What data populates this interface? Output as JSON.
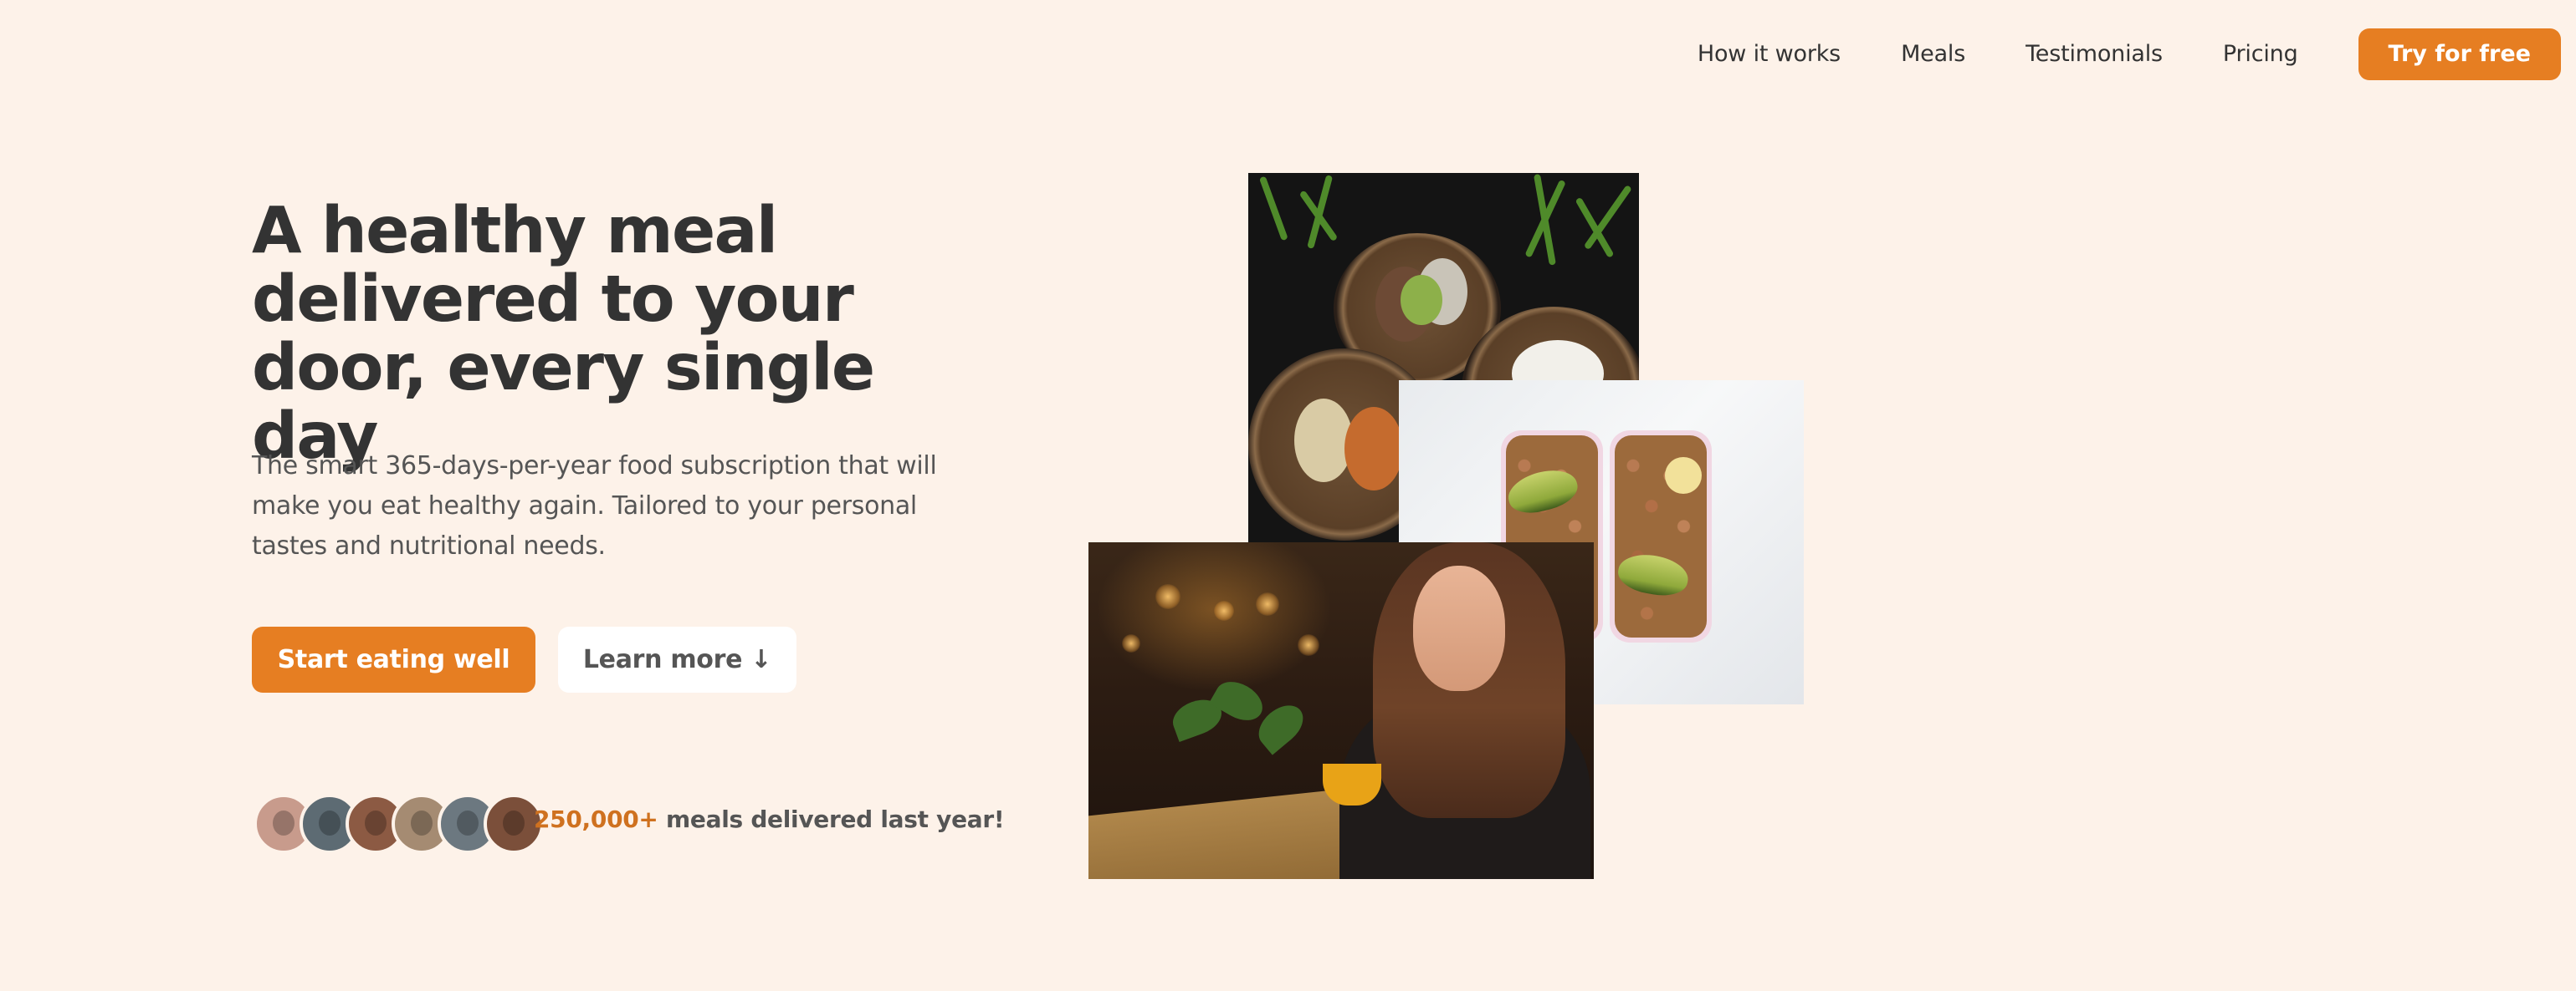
{
  "nav": {
    "links": [
      "How it works",
      "Meals",
      "Testimonials",
      "Pricing"
    ],
    "cta": "Try for free"
  },
  "hero": {
    "title": "A healthy meal delivered to your door, every single day",
    "description": "The smart 365-days-per-year food subscription that will make you eat healthy again. Tailored to your personal tastes and nutritional needs.",
    "primary_button": "Start eating well",
    "secondary_button": "Learn more ↓"
  },
  "delivered": {
    "count": "250,000+",
    "text": " meals delivered last year!",
    "avatars": [
      {
        "name": "customer-1",
        "color": "#c89b8c"
      },
      {
        "name": "customer-2",
        "color": "#5d6b73"
      },
      {
        "name": "customer-3",
        "color": "#8c5a43"
      },
      {
        "name": "customer-4",
        "color": "#a58b72"
      },
      {
        "name": "customer-5",
        "color": "#6c7880"
      },
      {
        "name": "customer-6",
        "color": "#7b4f3a"
      }
    ]
  },
  "images": {
    "bowls": "dinner-bowls-photo",
    "meal_boxes": "meal-prep-boxes-photo",
    "woman": "woman-eating-photo"
  },
  "colors": {
    "background": "#fdf2e9",
    "accent": "#e67e22",
    "text": "#333333"
  }
}
